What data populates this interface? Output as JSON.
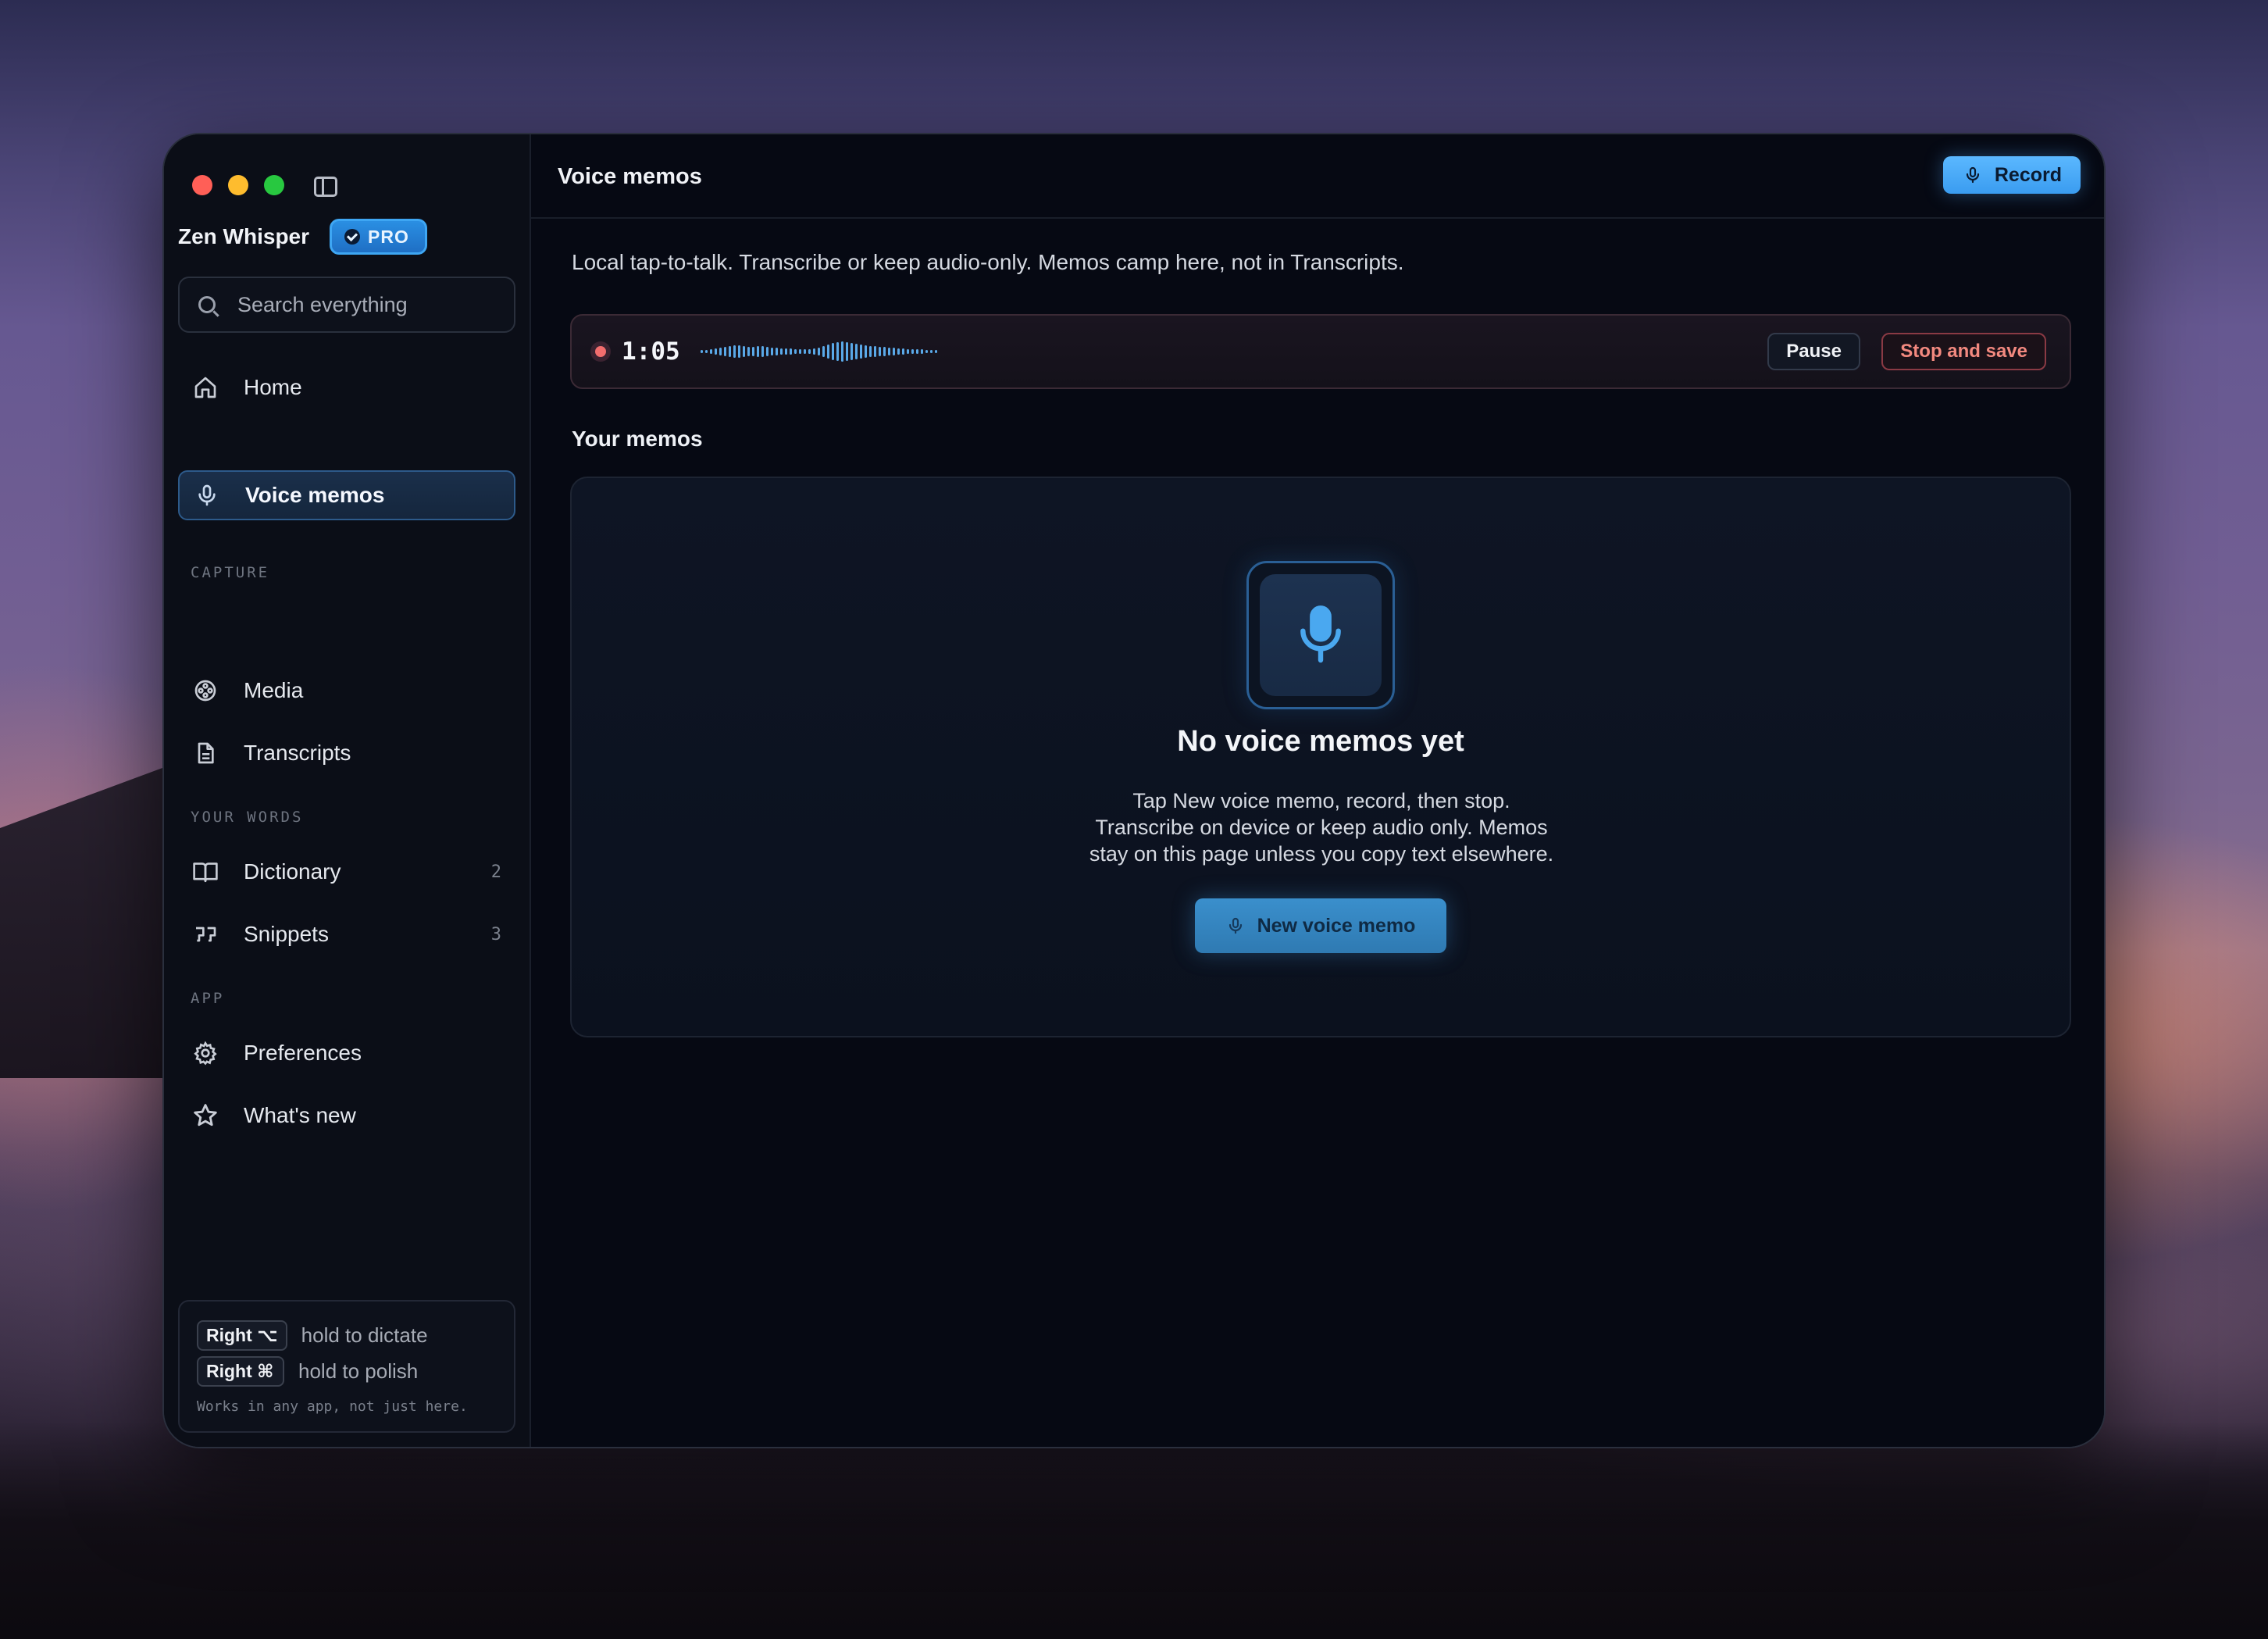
{
  "app": {
    "name": "Zen Whisper",
    "badge": "PRO"
  },
  "search": {
    "placeholder": "Search everything"
  },
  "sidebar": {
    "home": "Home",
    "sections": {
      "capture": "CAPTURE",
      "your_words": "YOUR WORDS",
      "app": "APP"
    },
    "items": [
      {
        "label": "Voice memos",
        "icon": "mic-icon",
        "active": true
      },
      {
        "label": "Media",
        "icon": "film-reel-icon"
      },
      {
        "label": "Transcripts",
        "icon": "document-icon"
      },
      {
        "label": "Dictionary",
        "icon": "book-icon",
        "count": "2"
      },
      {
        "label": "Snippets",
        "icon": "quote-icon",
        "count": "3"
      },
      {
        "label": "Preferences",
        "icon": "gear-icon"
      },
      {
        "label": "What's new",
        "icon": "star-icon"
      }
    ],
    "hotkeys": [
      {
        "key": "Right ⌥",
        "text": "hold to dictate"
      },
      {
        "key": "Right ⌘",
        "text": "hold to polish"
      }
    ],
    "hotkeys_note": "Works in any app, not just here."
  },
  "main": {
    "title": "Voice memos",
    "record_label": "Record",
    "subtitle": "Local tap-to-talk. Transcribe or keep audio-only. Memos camp here, not in Transcripts.",
    "recording": {
      "time": "1:05",
      "pause_label": "Pause",
      "stop_label": "Stop and save"
    },
    "memos_heading": "Your memos",
    "empty": {
      "title": "No voice memos yet",
      "lines": [
        "Tap New voice memo, record, then stop.",
        "Transcribe on device or keep audio only. Memos",
        "stay on this page unless you copy text elsewhere."
      ],
      "button_label": "New voice memo"
    }
  },
  "colors": {
    "accent": "#3a9cf0",
    "recording": "#f26d6d",
    "background": "#070a14"
  }
}
